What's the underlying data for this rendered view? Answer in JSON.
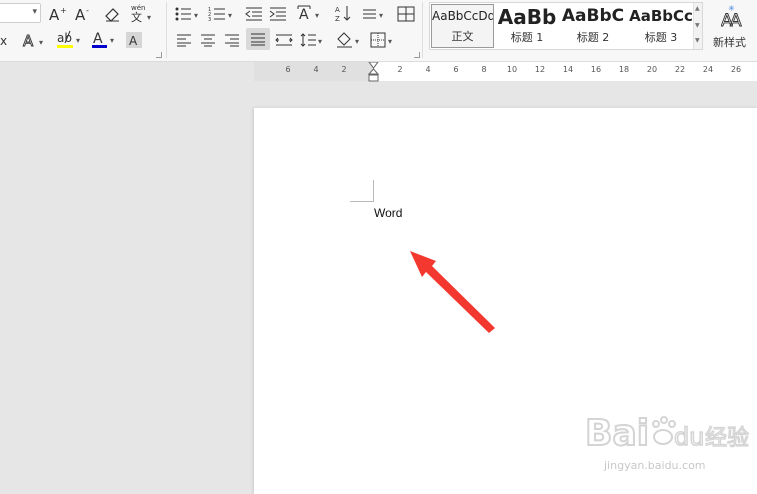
{
  "ribbon": {
    "style_gallery": {
      "items": [
        {
          "preview": "AaBbCcDd",
          "label": "正文",
          "selected": true
        },
        {
          "preview": "AaBb",
          "label": "标题 1"
        },
        {
          "preview": "AaBbC",
          "label": "标题 2"
        },
        {
          "preview": "AaBbCc",
          "label": "标题 3"
        }
      ]
    },
    "new_style_label": "新样式",
    "colors": {
      "highlight": "#ffff00",
      "font_color": "#0000cc"
    }
  },
  "ruler": {
    "ticks": [
      "6",
      "4",
      "2",
      "2",
      "4",
      "6",
      "8",
      "10",
      "12",
      "14",
      "16",
      "18",
      "20",
      "22",
      "24",
      "26"
    ]
  },
  "document": {
    "text": "Word"
  },
  "watermark": {
    "brand": "Baidu经验",
    "url": "jingyan.baidu.com"
  }
}
